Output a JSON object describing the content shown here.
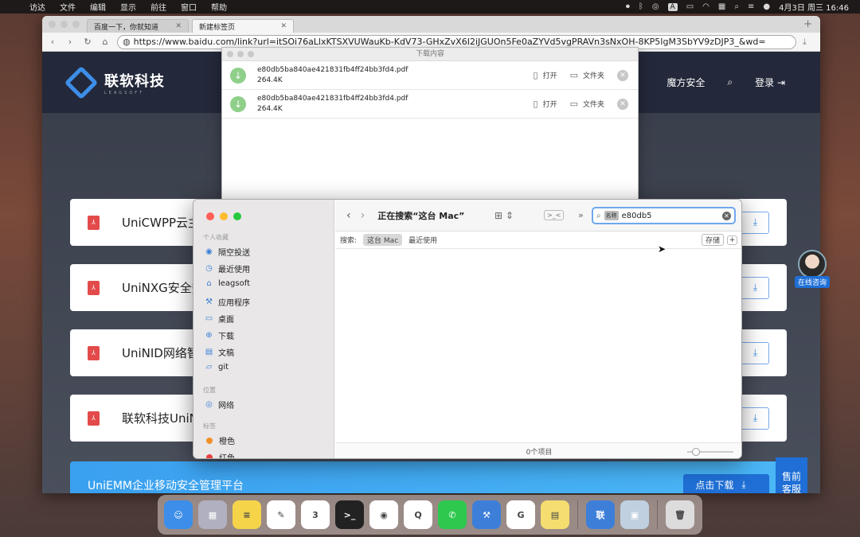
{
  "menubar": {
    "items": [
      "访达",
      "文件",
      "编辑",
      "显示",
      "前往",
      "窗口",
      "帮助"
    ],
    "clock": "4月3日 周三  16:46",
    "badge": "A"
  },
  "browser": {
    "tabs": [
      {
        "label": "百度一下，你就知道"
      },
      {
        "label": "新建标签页"
      }
    ],
    "url": "https://www.baidu.com/link?url=itSOi76aLlxKTSXVUWauKb-KdV73-GHxZvX6I2iJGUOn5Fe0aZYVd5vgPRAVn3sNxOH-8KP5IgM3SbYV9zDJP3_&wd="
  },
  "site": {
    "logo_text": "联软科技",
    "logo_sub": "LEAGSOFT",
    "nav": {
      "security": "魔方安全",
      "login": "登录"
    },
    "products": [
      {
        "title": "UniCWPP云主"
      },
      {
        "title": "UniNXG安全数"
      },
      {
        "title": "UniNID网络智"
      },
      {
        "title": "联软科技UniN"
      }
    ],
    "featured": {
      "title": "UniEMM企业移动安全管理平台",
      "download": "点击下载"
    },
    "service": {
      "line1": "售前",
      "line2": "客服"
    },
    "consult": "在线咨询"
  },
  "downloads": {
    "title": "下载内容",
    "items": [
      {
        "name": "e80db5ba840ae421831fb4ff24bb3fd4.pdf",
        "size": "264.4K",
        "open": "打开",
        "folder": "文件夹"
      },
      {
        "name": "e80db5ba840ae421831fb4ff24bb3fd4.pdf",
        "size": "264.4K",
        "open": "打开",
        "folder": "文件夹"
      }
    ]
  },
  "finder": {
    "title": "正在搜索“这台 Mac”",
    "search_token": "名称",
    "search_value": "e80db5",
    "scope_label": "搜索:",
    "scope_selected": "这台 Mac",
    "scope_other": "最近使用",
    "save": "存储",
    "status": "0个项目",
    "sidebar": {
      "favorites_header": "个人收藏",
      "favorites": [
        {
          "label": "隔空投送",
          "icon": "airdrop-icon",
          "glyph": "◉"
        },
        {
          "label": "最近使用",
          "icon": "clock-icon",
          "glyph": "◷"
        },
        {
          "label": "leagsoft",
          "icon": "home-icon",
          "glyph": "⌂"
        },
        {
          "label": "应用程序",
          "icon": "apps-icon",
          "glyph": "⚒"
        },
        {
          "label": "桌面",
          "icon": "desktop-icon",
          "glyph": "▭"
        },
        {
          "label": "下载",
          "icon": "download-icon",
          "glyph": "⊕"
        },
        {
          "label": "文稿",
          "icon": "doc-icon",
          "glyph": "▤"
        },
        {
          "label": "git",
          "icon": "folder-icon",
          "glyph": "▱"
        }
      ],
      "location_header": "位置",
      "locations": [
        {
          "label": "网络",
          "icon": "network-icon",
          "glyph": "◎"
        }
      ],
      "tags_header": "标签",
      "tags": [
        {
          "label": "橙色",
          "color": "#f0902a"
        },
        {
          "label": "红色",
          "color": "#e84040"
        }
      ]
    }
  },
  "dock": {
    "apps": [
      {
        "name": "finder",
        "color": "#3d8ee8",
        "glyph": "☺"
      },
      {
        "name": "launchpad",
        "color": "#b0b0c0",
        "glyph": "▦"
      },
      {
        "name": "notes",
        "color": "#f5d44a",
        "glyph": "≡"
      },
      {
        "name": "freeform",
        "color": "#ffffff",
        "glyph": "✎"
      },
      {
        "name": "calendar",
        "color": "#ffffff",
        "glyph": "3"
      },
      {
        "name": "terminal",
        "color": "#222222",
        "glyph": ">_"
      },
      {
        "name": "chrome",
        "color": "#ffffff",
        "glyph": "◉"
      },
      {
        "name": "quicktime",
        "color": "#ffffff",
        "glyph": "Q"
      },
      {
        "name": "wechat",
        "color": "#2dc84d",
        "glyph": "✆"
      },
      {
        "name": "xcode",
        "color": "#3d7fd8",
        "glyph": "⚒"
      },
      {
        "name": "app-g",
        "color": "#ffffff",
        "glyph": "G"
      },
      {
        "name": "stickies",
        "color": "#f5dd70",
        "glyph": "▤"
      },
      {
        "name": "leagsoft",
        "color": "#3d7fd8",
        "glyph": "联"
      },
      {
        "name": "preview",
        "color": "#c0d0e0",
        "glyph": "▣"
      },
      {
        "name": "trash",
        "color": "#dcdcdc",
        "glyph": "🗑"
      }
    ]
  }
}
